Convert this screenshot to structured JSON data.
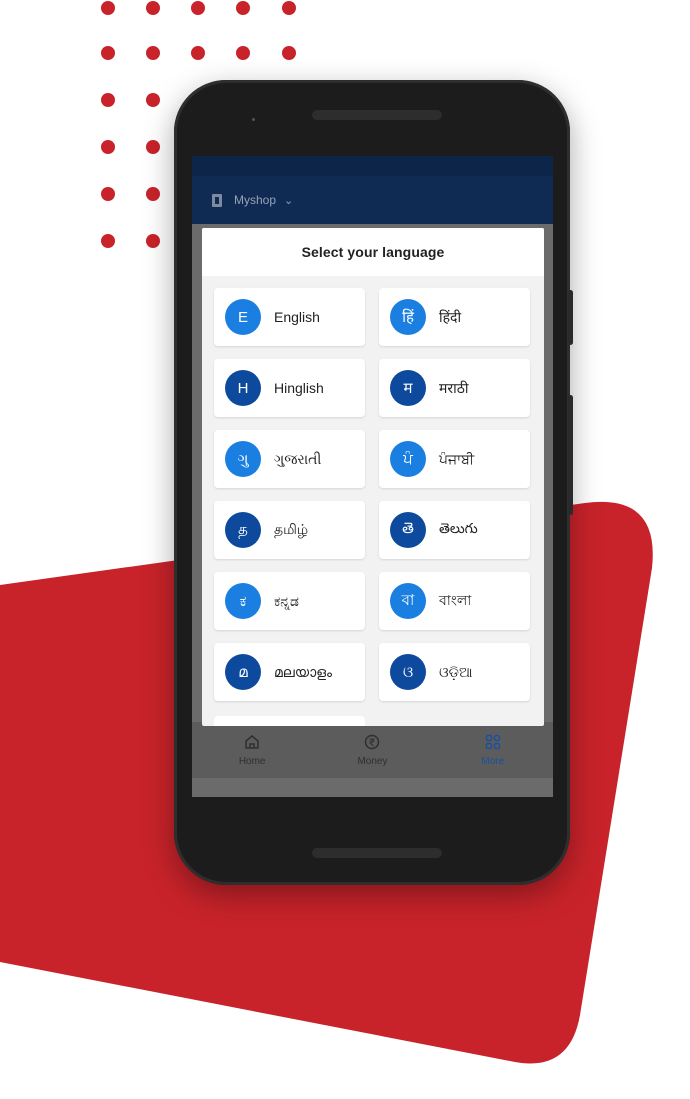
{
  "colors": {
    "accent_red": "#c8232a",
    "header_navy": "#0f2a53",
    "avatar_light_blue": "#1a7fe0",
    "avatar_dark_blue": "#0d4a9e",
    "nav_active": "#1a4fa0"
  },
  "app": {
    "shop_name": "Myshop",
    "shop_icon": "shop-icon",
    "dropdown_icon": "chevron-down-icon"
  },
  "modal": {
    "title": "Select your language",
    "languages": [
      {
        "letter": "E",
        "label": "English",
        "color": "#1a7fe0"
      },
      {
        "letter": "हिं",
        "label": "हिंदी",
        "color": "#1a7fe0"
      },
      {
        "letter": "H",
        "label": "Hinglish",
        "color": "#0d4a9e"
      },
      {
        "letter": "म",
        "label": "मराठी",
        "color": "#0d4a9e"
      },
      {
        "letter": "ગુ",
        "label": "ગુજરાતી",
        "color": "#1a7fe0"
      },
      {
        "letter": "ਪੰ",
        "label": "ਪੰਜਾਬੀ",
        "color": "#1a7fe0"
      },
      {
        "letter": "த",
        "label": "தமிழ்",
        "color": "#0d4a9e"
      },
      {
        "letter": "తె",
        "label": "తెలుగు",
        "color": "#0d4a9e"
      },
      {
        "letter": "ಕ",
        "label": "ಕನ್ನಡ",
        "color": "#1a7fe0"
      },
      {
        "letter": "বা",
        "label": "বাংলা",
        "color": "#1a7fe0"
      },
      {
        "letter": "മ",
        "label": "മലയാളം",
        "color": "#0d4a9e"
      },
      {
        "letter": "ଓ",
        "label": "ଓଡ଼ିଆ",
        "color": "#0d4a9e"
      }
    ]
  },
  "bottom_nav": [
    {
      "label": "Home",
      "icon": "home-icon",
      "active": false
    },
    {
      "label": "Money",
      "icon": "rupee-icon",
      "active": false
    },
    {
      "label": "More",
      "icon": "grid-icon",
      "active": true
    }
  ]
}
